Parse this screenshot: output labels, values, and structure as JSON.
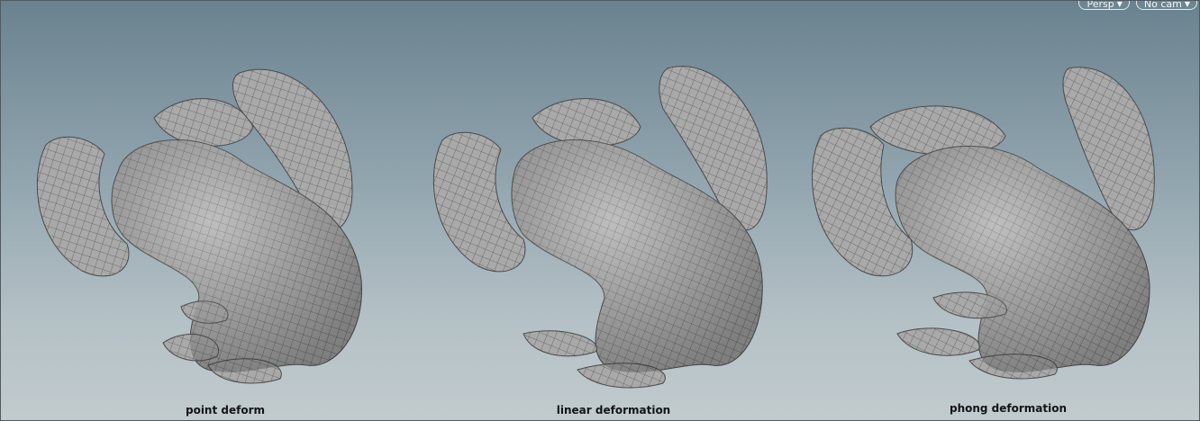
{
  "viewport": {
    "menus": [
      {
        "label": "Persp",
        "icon": "chevron-down-icon"
      },
      {
        "label": "No cam",
        "icon": "chevron-down-icon"
      }
    ]
  },
  "models": [
    {
      "label": "point deform"
    },
    {
      "label": "linear deformation"
    },
    {
      "label": "phong deformation"
    }
  ],
  "colors": {
    "mesh_fill": "#a7a7a7",
    "mesh_wire": "#555555",
    "label_text": "#121416"
  }
}
